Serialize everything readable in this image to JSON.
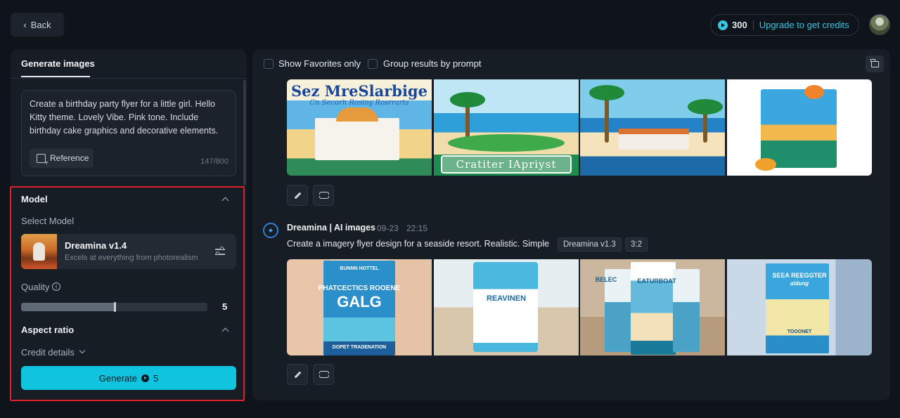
{
  "header": {
    "back_label": "Back",
    "credits": "300",
    "upgrade_label": "Upgrade to get credits"
  },
  "left_panel": {
    "tab_label": "Generate images",
    "prompt": "Create a birthday party flyer for a little girl. Hello Kitty theme. Lovely Vibe. Pink tone. Include birthday cake graphics and decorative elements.",
    "reference_label": "Reference",
    "char_count": "147/800",
    "model_section_title": "Model",
    "select_model_label": "Select Model",
    "model_name": "Dreamina v1.4",
    "model_desc": "Excels at everything from photorealism",
    "quality_label": "Quality",
    "quality_value": "5",
    "quality_fraction": 0.5,
    "aspect_ratio_label": "Aspect ratio",
    "credit_details_label": "Credit details",
    "generate_label": "Generate",
    "generate_cost": "5"
  },
  "right_panel": {
    "show_favorites_label": "Show Favorites only",
    "group_results_label": "Group results by prompt",
    "group1": {
      "thumb1_title": "Sez MreSlarbige",
      "thumb1_sub": "Cn Secorh Rosiny Rosrrarts",
      "thumb2_caption": "Cratiter IApriyst"
    },
    "group2": {
      "source": "Dreamina | AI images",
      "date": "09-23",
      "time": "22:15",
      "prompt": "Create a imagery flyer design for a seaside resort.  Realistic. Simple",
      "model_tag": "Dreamina v1.3",
      "ratio_tag": "3:2",
      "poster1_top": "BUNNN HOTTEL",
      "poster1_mid": "PHATCECTICS ROOENE",
      "poster1_big": "GALG",
      "poster1_bottom": "DOPET TRADENATION",
      "poster2_title": "REAVINEN",
      "poster3_title": "EATURBOAT",
      "poster3_side": "BELEC",
      "poster4_title": "SEEA REEGGTER",
      "poster4_sub": "aldung",
      "poster4_badge": "TOOONET"
    }
  },
  "colors": {
    "accent": "#10c3df",
    "link": "#33c5e4",
    "highlight": "#e0212b"
  }
}
